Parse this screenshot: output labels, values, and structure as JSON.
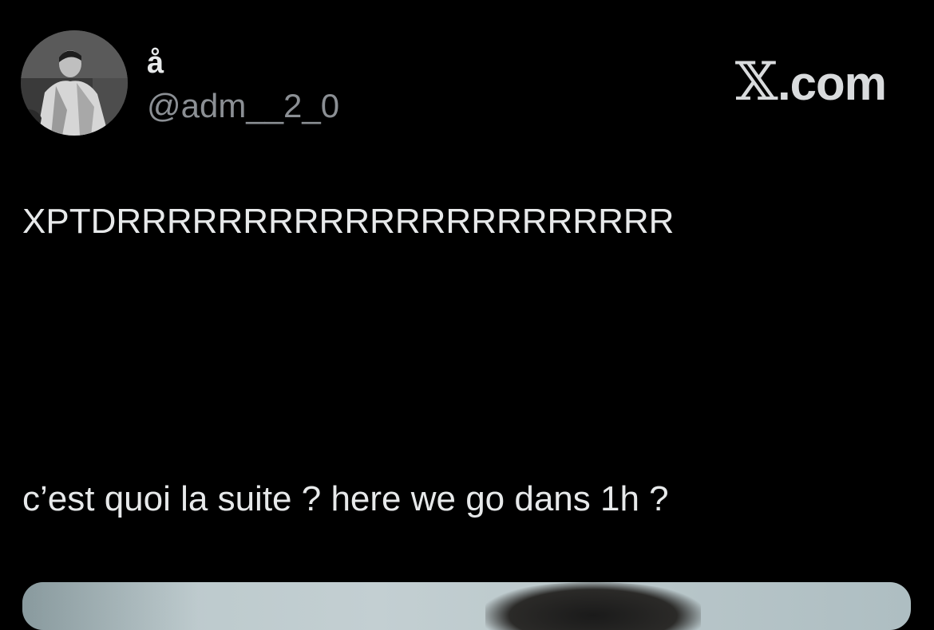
{
  "header": {
    "display_name": "å",
    "handle": "@adm__2_0",
    "brand": {
      "mark": "𝕏",
      "text": ".com"
    },
    "avatar_icon": "user-avatar-photo"
  },
  "tweet": {
    "lines": [
      "XPTDRRRRRRRRRRRRRRRRRRRRRR",
      "c’est quoi la suite ? here we go dans 1h ?"
    ],
    "media_icon": "attached-image"
  },
  "colors": {
    "background": "#000000",
    "text_primary": "#e7e9ea",
    "text_secondary": "#8b8f94",
    "brand": "#d9dbdd"
  }
}
